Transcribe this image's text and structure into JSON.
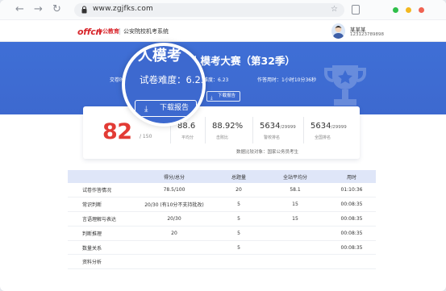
{
  "browser": {
    "url": "www.zgjfks.com",
    "back_icon": "←",
    "forward_icon": "→",
    "reload_icon": "↻",
    "star_icon": "☆",
    "window_dot_colors": [
      "#2fbf4a",
      "#f3b820",
      "#f06352"
    ]
  },
  "header": {
    "logo_text": "offcn",
    "brand": "中公教育",
    "system_title": "公安院校机考系统",
    "user_name": "某某某",
    "user_phone": "12312378989​8"
  },
  "hero": {
    "title": "人模考大赛（第32季）",
    "meta": {
      "left": "交卷时",
      "difficulty": "试卷难度：6.23",
      "time_used": "作答用时：1小时10分36秒"
    },
    "download_small": "下载报告"
  },
  "lens": {
    "title": "人模考",
    "difficulty": "试卷难度：6.23",
    "download_label": "下载报告",
    "download_icon": "⤓"
  },
  "score": {
    "value": "82",
    "total": "/ 150",
    "stats": [
      {
        "value": "88.6",
        "suffix": "",
        "label": "平均分"
      },
      {
        "value": "88.92%",
        "suffix": "",
        "label": "击败比"
      },
      {
        "value": "5634",
        "suffix": "/29999",
        "label": "警校排名"
      },
      {
        "value": "5634",
        "suffix": "/29999",
        "label": "全国排名"
      }
    ],
    "source_note": "数据比较对象：国家公务员考生"
  },
  "table": {
    "headers": [
      "",
      "得分/总分",
      "总题量",
      "全站平均分",
      "用时"
    ],
    "rows": [
      [
        "试卷作答情况",
        "78.5/100",
        "20",
        "58.1",
        "01:10:36"
      ],
      [
        "常识判断",
        "20/30 (有10分不支持批改)",
        "5",
        "15",
        "00:08:35"
      ],
      [
        "言语理解与表达",
        "20/30",
        "5",
        "15",
        "00:08:35"
      ],
      [
        "判断推理",
        "20",
        "5",
        "",
        "00:08:35"
      ],
      [
        "数量关系",
        "",
        "5",
        "",
        "00:08:35"
      ],
      [
        "资料分析",
        "",
        "",
        "",
        ""
      ]
    ]
  },
  "colors": {
    "hero_blue": "#3d69cf",
    "score_red": "#e23b35",
    "brand_red": "#d8262c",
    "table_header": "#dfe6f8"
  }
}
